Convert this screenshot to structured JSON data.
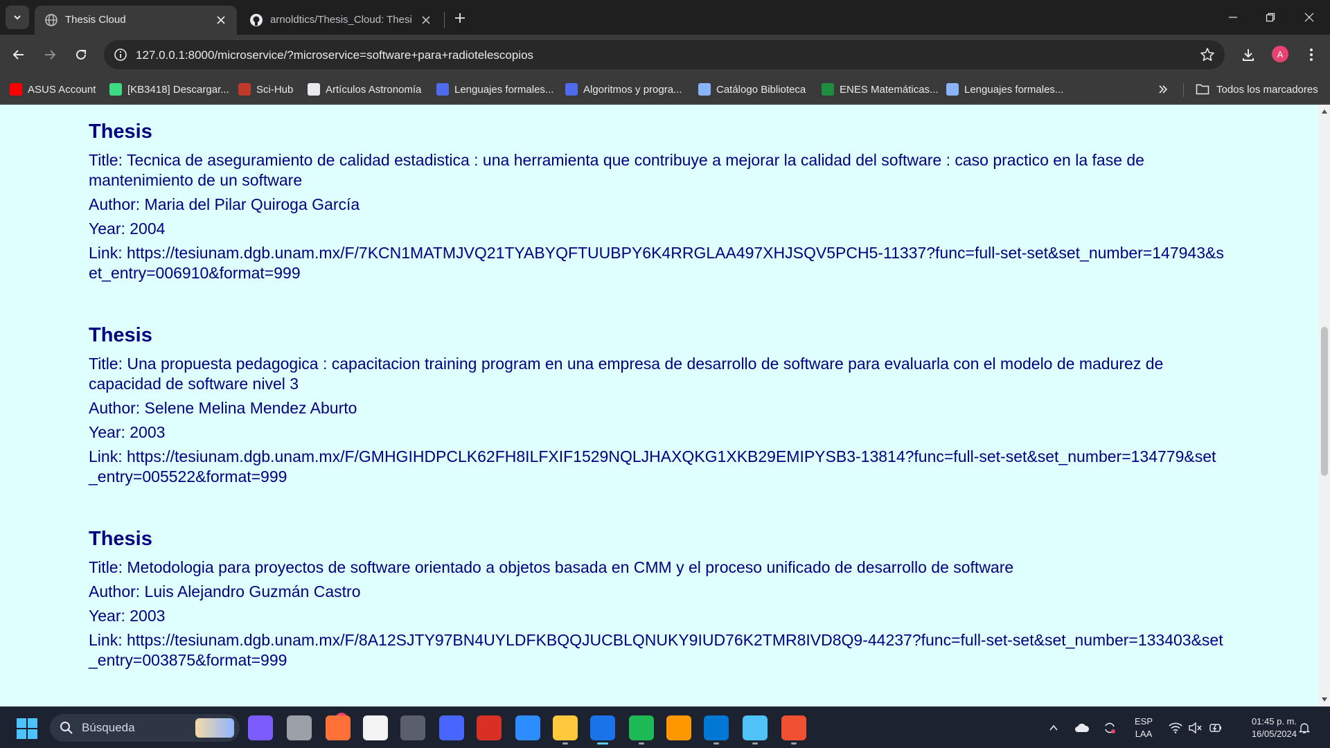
{
  "tabs": [
    {
      "title": "Thesis Cloud",
      "favicon": "globe-icon"
    },
    {
      "title": "arnoldtics/Thesis_Cloud: Thesis",
      "favicon": "github-icon"
    }
  ],
  "address_bar": {
    "url": "127.0.0.1:8000/microservice/?microservice=software+para+radiotelescopios"
  },
  "profile": {
    "initial": "A"
  },
  "bookmarks": [
    {
      "label": "ASUS Account",
      "icon": "youtube-icon",
      "color": "#ff0000"
    },
    {
      "label": "[KB3418] Descargar...",
      "icon": "kb-icon",
      "color": "#3ddc84"
    },
    {
      "label": "Sci-Hub",
      "icon": "scihub-icon",
      "color": "#c0392b"
    },
    {
      "label": "Artículos Astronomía",
      "icon": "book-icon",
      "color": "#e8eaed"
    },
    {
      "label": "Lenguajes formales...",
      "icon": "calendar-icon",
      "color": "#4f6bed"
    },
    {
      "label": "Algoritmos y progra...",
      "icon": "calendar-icon",
      "color": "#4f6bed"
    },
    {
      "label": "Catálogo Biblioteca",
      "icon": "qr-icon",
      "color": "#8ab4f8"
    },
    {
      "label": "ENES Matemáticas...",
      "icon": "leaf-icon",
      "color": "#1e8e3e"
    },
    {
      "label": "Lenguajes formales...",
      "icon": "calendar-icon",
      "color": "#8ab4f8"
    }
  ],
  "all_bookmarks_label": "Todos los marcadores",
  "theses": [
    {
      "heading": "Thesis",
      "title": "Title: Tecnica de aseguramiento de calidad estadistica : una herramienta que contribuye a mejorar la calidad del software : caso practico en la fase de mantenimiento de un software",
      "author": "Author: Maria del Pilar Quiroga García",
      "year": "Year: 2004",
      "link": "Link: https://tesiunam.dgb.unam.mx/F/7KCN1MATMJVQ21TYABYQFTUUBPY6K4RRGLAA497XHJSQV5PCH5-11337?func=full-set-set&set_number=147943&set_entry=006910&format=999"
    },
    {
      "heading": "Thesis",
      "title": "Title: Una propuesta pedagogica : capacitacion training program en una empresa de desarrollo de software para evaluarla con el modelo de madurez de capacidad de software nivel 3",
      "author": "Author: Selene Melina Mendez Aburto",
      "year": "Year: 2003",
      "link": "Link: https://tesiunam.dgb.unam.mx/F/GMHGIHDPCLK62FH8ILFXIF1529NQLJHAXQKG1XKB29EMIPYSB3-13814?func=full-set-set&set_number=134779&set_entry=005522&format=999"
    },
    {
      "heading": "Thesis",
      "title": "Title: Metodologia para proyectos de software orientado a objetos basada en CMM y el proceso unificado de desarrollo de software",
      "author": "Author: Luis Alejandro Guzmán Castro",
      "year": "Year: 2003",
      "link": "Link: https://tesiunam.dgb.unam.mx/F/8A12SJTY97BN4UYLDFKBQQJUCBLQNUKY9IUD76K2TMR8IVD8Q9-44237?func=full-set-set&set_number=133403&set_entry=003875&format=999"
    }
  ],
  "taskbar": {
    "search_placeholder": "Búsqueda",
    "notification_badge": "1",
    "apps": [
      {
        "name": "copilot-icon",
        "color": "#7b5cff"
      },
      {
        "name": "taskview-icon",
        "color": "#9aa0a6"
      },
      {
        "name": "firefox-icon",
        "color": "#ff7139"
      },
      {
        "name": "store-icon",
        "color": "#f3f3f3"
      },
      {
        "name": "unity-icon",
        "color": "#5a5f6b"
      },
      {
        "name": "mathworks-icon",
        "color": "#4666ff"
      },
      {
        "name": "ccleaner-icon",
        "color": "#d93025"
      },
      {
        "name": "zoom-icon",
        "color": "#2d8cff"
      },
      {
        "name": "file-explorer-icon",
        "color": "#ffc83d"
      },
      {
        "name": "chrome-icon",
        "color": "#1a73e8"
      },
      {
        "name": "spotify-icon",
        "color": "#1db954"
      },
      {
        "name": "sublime-icon",
        "color": "#ff9800"
      },
      {
        "name": "vscode-icon",
        "color": "#0078d4"
      },
      {
        "name": "notepad-icon",
        "color": "#4fc3f7"
      },
      {
        "name": "git-icon",
        "color": "#f05133"
      }
    ],
    "language": "ESP",
    "keyboard": "LAA",
    "time": "01:45 p. m.",
    "date": "16/05/2024"
  }
}
